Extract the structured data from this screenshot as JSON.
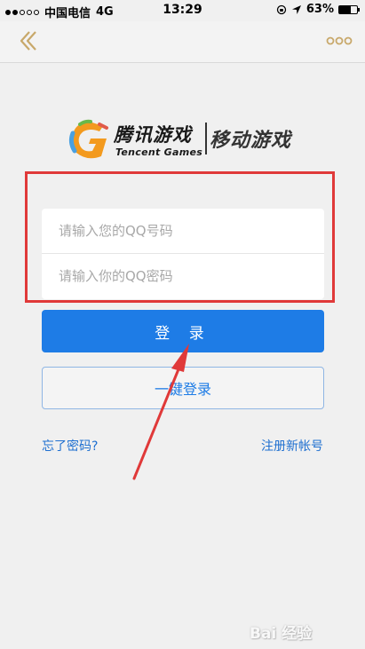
{
  "status_bar": {
    "carrier": "中国电信",
    "network": "4G",
    "time": "13:29",
    "battery": "63%",
    "battery_level": 0.63,
    "signal_bars": [
      true,
      true,
      false,
      false,
      false
    ]
  },
  "nav": {
    "back_icon": "chevron-left-icon",
    "more_icon": "more-dots-icon",
    "accent_color": "#c8a86a"
  },
  "logo": {
    "brand_cn": "腾讯游戏",
    "brand_en": "Tencent Games",
    "product": "移动游戏"
  },
  "form": {
    "qq_number_placeholder": "请输入您的QQ号码",
    "qq_password_placeholder": "请输入你的QQ密码",
    "qq_number_value": "",
    "qq_password_value": "",
    "login_label": "登 录",
    "quick_login_label": "一键登录",
    "forgot_label": "忘了密码?",
    "register_label": "注册新帐号"
  },
  "annotation": {
    "highlight_color": "#e03939",
    "arrow_color": "#e03939"
  },
  "watermark": {
    "text": "Bai 经验"
  },
  "colors": {
    "primary": "#1e7ce6",
    "background": "#f0f0f0",
    "link": "#1e6fd0"
  }
}
